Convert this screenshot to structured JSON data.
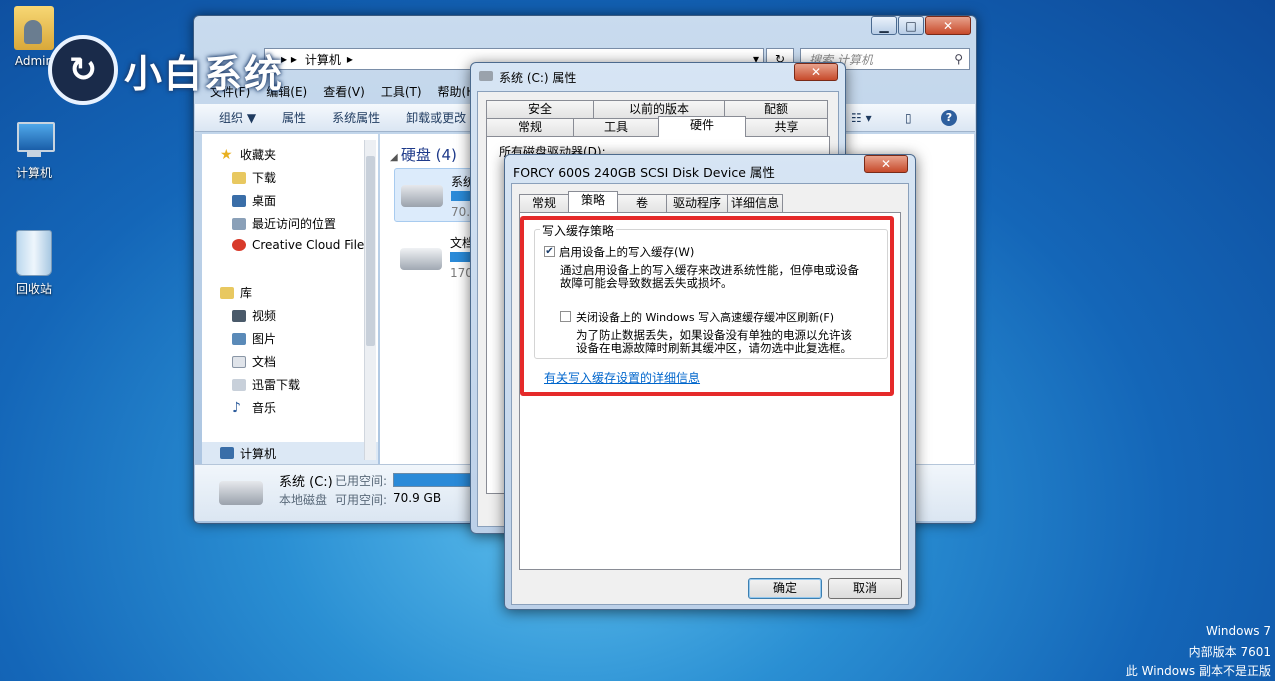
{
  "desktop": {
    "icons": [
      {
        "label": "Admin",
        "icon": "user-folder-icon"
      },
      {
        "label": "计算机",
        "icon": "computer-icon"
      },
      {
        "label": "回收站",
        "icon": "recycle-bin-icon"
      }
    ],
    "logo_text": "小白系统",
    "watermark": [
      "Windows 7",
      "内部版本 7601",
      "此 Windows 副本不是正版"
    ]
  },
  "explorer": {
    "address": [
      "计算机"
    ],
    "search_placeholder": "搜索 计算机",
    "menu": [
      "文件(F)",
      "编辑(E)",
      "查看(V)",
      "工具(T)",
      "帮助(H)"
    ],
    "toolbar": [
      "组织 ▼",
      "属性",
      "系统属性",
      "卸载或更改"
    ],
    "nav": {
      "favorites": "收藏夹",
      "fav_items": [
        "下载",
        "桌面",
        "最近访问的位置",
        "Creative Cloud Files"
      ],
      "libraries": "库",
      "lib_items": [
        "视频",
        "图片",
        "文档",
        "迅雷下载",
        "音乐"
      ],
      "computer": "计算机"
    },
    "group_header": "硬盘 (4)",
    "drives": [
      {
        "name": "系统",
        "size": "70."
      },
      {
        "name": "文档",
        "size": "170"
      }
    ],
    "status": {
      "drive_name": "系统 (C:)",
      "used_label": "已用空间:",
      "type": "本地磁盘",
      "free_label": "可用空间:",
      "free_value": "70.9 GB"
    }
  },
  "props_dialog": {
    "title": "系统 (C:) 属性",
    "tabs_row1": [
      "安全",
      "以前的版本",
      "配额"
    ],
    "tabs_row2": [
      "常规",
      "工具",
      "硬件",
      "共享"
    ],
    "active_tab": "硬件",
    "partial_text": "所有磁盘驱动器(D):"
  },
  "device_dialog": {
    "title": "FORCY 600S 240GB SCSI Disk Device 属性",
    "tabs": [
      "常规",
      "策略",
      "卷",
      "驱动程序",
      "详细信息"
    ],
    "active_tab": "策略",
    "group_label": "写入缓存策略",
    "option1": {
      "checked": true,
      "label": "启用设备上的写入缓存(W)",
      "desc1": "通过启用设备上的写入缓存来改进系统性能，但停电或设备",
      "desc2": "故障可能会导致数据丢失或损坏。"
    },
    "option2": {
      "checked": false,
      "label": "关闭设备上的 Windows 写入高速缓存缓冲区刷新(F)",
      "desc1": "为了防止数据丢失，如果设备没有单独的电源以允许该",
      "desc2": "设备在电源故障时刷新其缓冲区，请勿选中此复选框。"
    },
    "link": "有关写入缓存设置的详细信息",
    "ok": "确定",
    "cancel": "取消"
  },
  "colors": {
    "highlight_box": "#e52a2a",
    "link": "#0066cc"
  }
}
